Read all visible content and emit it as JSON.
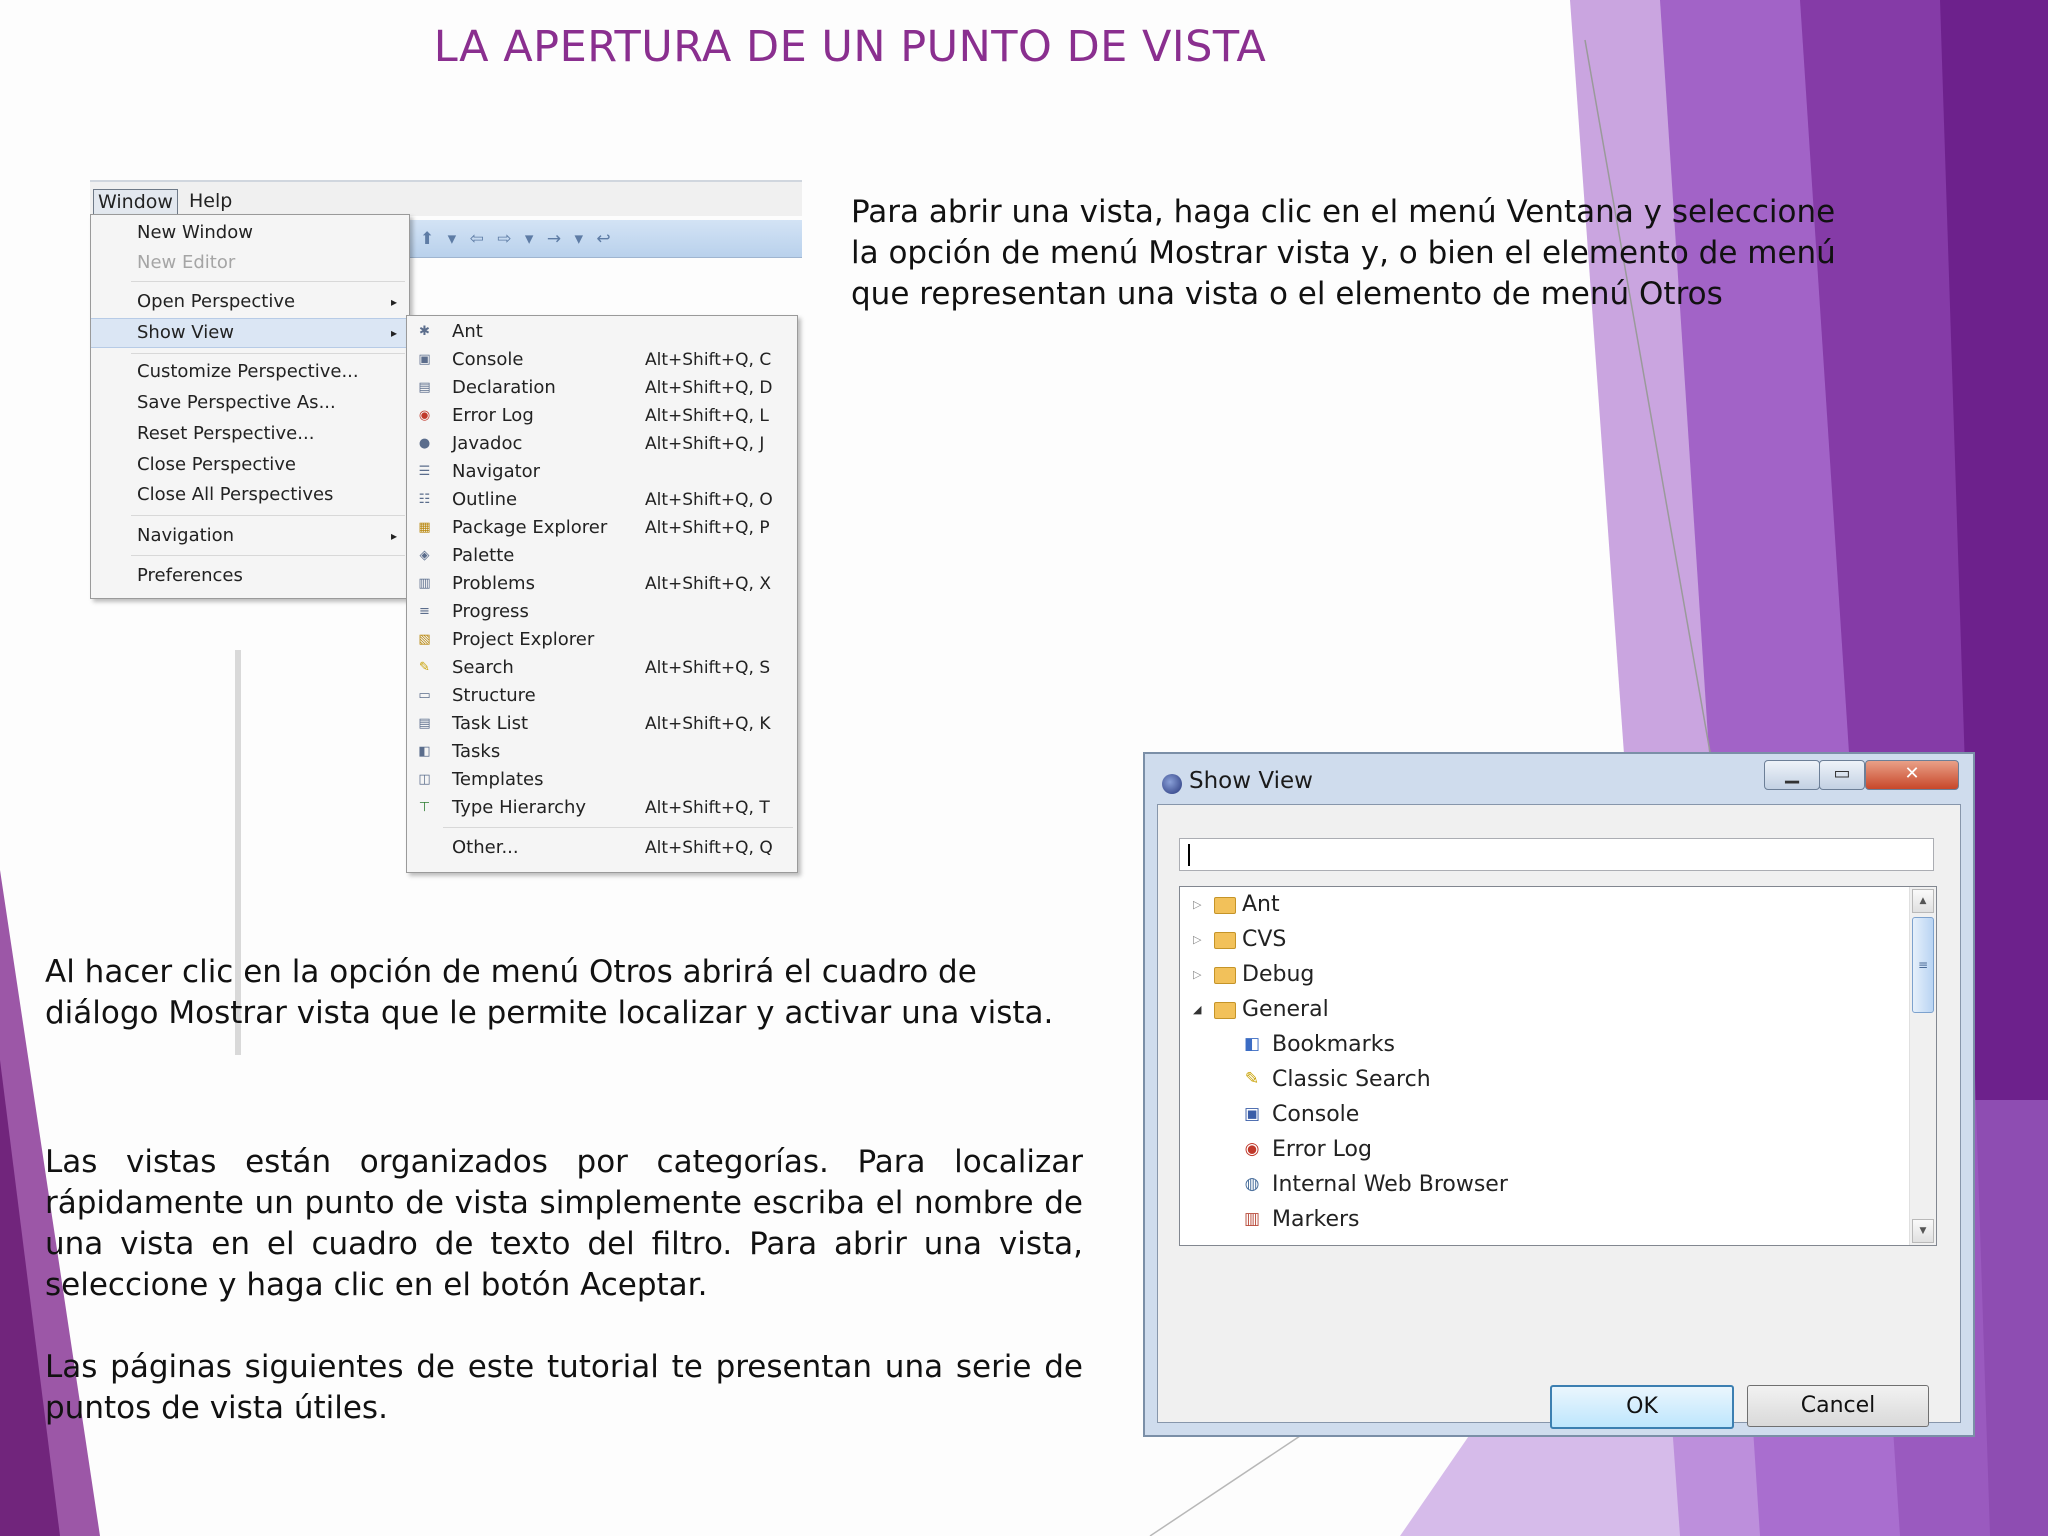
{
  "slide": {
    "title": "LA APERTURA DE UN PUNTO DE VISTA",
    "para_top": "Para abrir una vista, haga clic en el menú Ventana y seleccione la opción de menú Mostrar vista y, o bien el elemento de menú que representan una vista o el elemento de menú Otros",
    "para_mid": "Al hacer clic en la opción de menú Otros abrirá el cuadro de diálogo Mostrar vista que le permite localizar y activar una vista.",
    "para_low1": "Las vistas están organizados por categorías. Para localizar rápidamente un punto de vista simplemente escriba el nombre de una vista en el cuadro de texto del filtro. Para abrir una vista, seleccione y haga clic en el botón Aceptar.",
    "para_low2": "Las páginas siguientes de este tutorial te presentan una serie de puntos de vista útiles.",
    "accent_color": "#8a2f8f"
  },
  "eclipse": {
    "menubar": [
      "Window",
      "Help"
    ],
    "window_menu": [
      {
        "label": "New Window"
      },
      {
        "label": "New Editor",
        "disabled": true
      },
      {
        "label": "Open Perspective",
        "submenu": true
      },
      {
        "label": "Show View",
        "submenu": true,
        "highlighted": true
      },
      {
        "label": "Customize Perspective..."
      },
      {
        "label": "Save Perspective As..."
      },
      {
        "label": "Reset Perspective..."
      },
      {
        "label": "Close Perspective"
      },
      {
        "label": "Close All Perspectives"
      },
      {
        "label": "Navigation",
        "submenu": true
      },
      {
        "label": "Preferences"
      }
    ],
    "show_view_menu": [
      {
        "label": "Ant",
        "shortcut": "",
        "icon": "ant-icon"
      },
      {
        "label": "Console",
        "shortcut": "Alt+Shift+Q, C",
        "icon": "console-icon"
      },
      {
        "label": "Declaration",
        "shortcut": "Alt+Shift+Q, D",
        "icon": "declaration-icon"
      },
      {
        "label": "Error Log",
        "shortcut": "Alt+Shift+Q, L",
        "icon": "error-log-icon"
      },
      {
        "label": "Javadoc",
        "shortcut": "Alt+Shift+Q, J",
        "icon": "javadoc-icon"
      },
      {
        "label": "Navigator",
        "shortcut": "",
        "icon": "navigator-icon"
      },
      {
        "label": "Outline",
        "shortcut": "Alt+Shift+Q, O",
        "icon": "outline-icon"
      },
      {
        "label": "Package Explorer",
        "shortcut": "Alt+Shift+Q, P",
        "icon": "package-explorer-icon"
      },
      {
        "label": "Palette",
        "shortcut": "",
        "icon": "palette-icon"
      },
      {
        "label": "Problems",
        "shortcut": "Alt+Shift+Q, X",
        "icon": "problems-icon"
      },
      {
        "label": "Progress",
        "shortcut": "",
        "icon": "progress-icon"
      },
      {
        "label": "Project Explorer",
        "shortcut": "",
        "icon": "project-explorer-icon"
      },
      {
        "label": "Search",
        "shortcut": "Alt+Shift+Q, S",
        "icon": "search-icon"
      },
      {
        "label": "Structure",
        "shortcut": "",
        "icon": "structure-icon"
      },
      {
        "label": "Task List",
        "shortcut": "Alt+Shift+Q, K",
        "icon": "task-list-icon"
      },
      {
        "label": "Tasks",
        "shortcut": "",
        "icon": "tasks-icon"
      },
      {
        "label": "Templates",
        "shortcut": "",
        "icon": "templates-icon"
      },
      {
        "label": "Type Hierarchy",
        "shortcut": "Alt+Shift+Q, T",
        "icon": "type-hierarchy-icon"
      },
      {
        "label": "Other...",
        "shortcut": "Alt+Shift+Q, Q",
        "icon": ""
      }
    ]
  },
  "dialog": {
    "title": "Show View",
    "filter_value": "",
    "tree": [
      {
        "label": "Ant",
        "type": "folder",
        "expanded": false
      },
      {
        "label": "CVS",
        "type": "folder",
        "expanded": false
      },
      {
        "label": "Debug",
        "type": "folder",
        "expanded": false
      },
      {
        "label": "General",
        "type": "folder",
        "expanded": true
      },
      {
        "label": "Bookmarks",
        "type": "leaf",
        "icon": "bookmarks-icon"
      },
      {
        "label": "Classic Search",
        "type": "leaf",
        "icon": "search-icon"
      },
      {
        "label": "Console",
        "type": "leaf",
        "icon": "console-icon"
      },
      {
        "label": "Error Log",
        "type": "leaf",
        "icon": "error-log-icon"
      },
      {
        "label": "Internal Web Browser",
        "type": "leaf",
        "icon": "globe-icon"
      },
      {
        "label": "Markers",
        "type": "leaf",
        "icon": "markers-icon"
      }
    ],
    "ok_label": "OK",
    "cancel_label": "Cancel"
  }
}
